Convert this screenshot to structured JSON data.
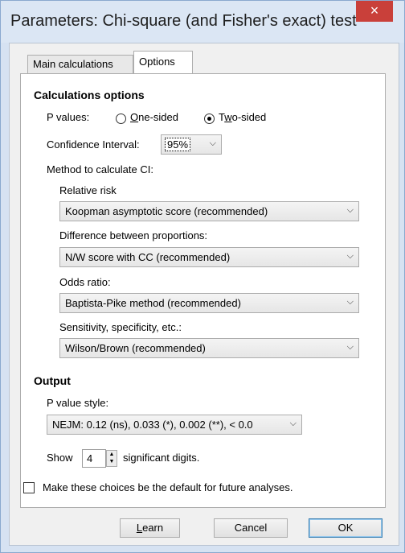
{
  "window": {
    "title": "Parameters: Chi-square (and Fisher's exact) test",
    "close_icon": "×"
  },
  "tabs": [
    {
      "label": "Main calculations",
      "active": false
    },
    {
      "label": "Options",
      "active": true
    }
  ],
  "calc": {
    "heading": "Calculations options",
    "pvalues_label": "P values:",
    "one_sided": {
      "pre": "",
      "mnemonic": "O",
      "post": "ne-sided",
      "checked": false
    },
    "two_sided": {
      "pre": "T",
      "mnemonic": "w",
      "post": "o-sided",
      "checked": true
    },
    "ci_label": "Confidence Interval:",
    "ci_value": "95%",
    "method_label": "Method to calculate CI:",
    "relative_risk_label": "Relative risk",
    "relative_risk_value": "Koopman asymptotic score (recommended)",
    "diff_label": "Difference between proportions:",
    "diff_value": "N/W score with CC (recommended)",
    "odds_label": "Odds ratio:",
    "odds_value": "Baptista-Pike method (recommended)",
    "sens_label": "Sensitivity, specificity, etc.:",
    "sens_value": "Wilson/Brown (recommended)"
  },
  "output": {
    "heading": "Output",
    "pstyle_label": "P value style:",
    "pstyle_value": "NEJM: 0.12 (ns), 0.033 (*), 0.002 (**), < 0.0",
    "show_label": "Show",
    "digits_value": "4",
    "sig_label": "significant digits."
  },
  "default_checkbox": {
    "label": "Make these choices be the default for future analyses.",
    "checked": false
  },
  "buttons": {
    "learn": {
      "mnemonic": "L",
      "rest": "earn"
    },
    "cancel": "Cancel",
    "ok": "OK"
  },
  "icons": {
    "dropdown": "chevron-down-icon",
    "spin_up": "▲",
    "spin_down": "▼"
  }
}
